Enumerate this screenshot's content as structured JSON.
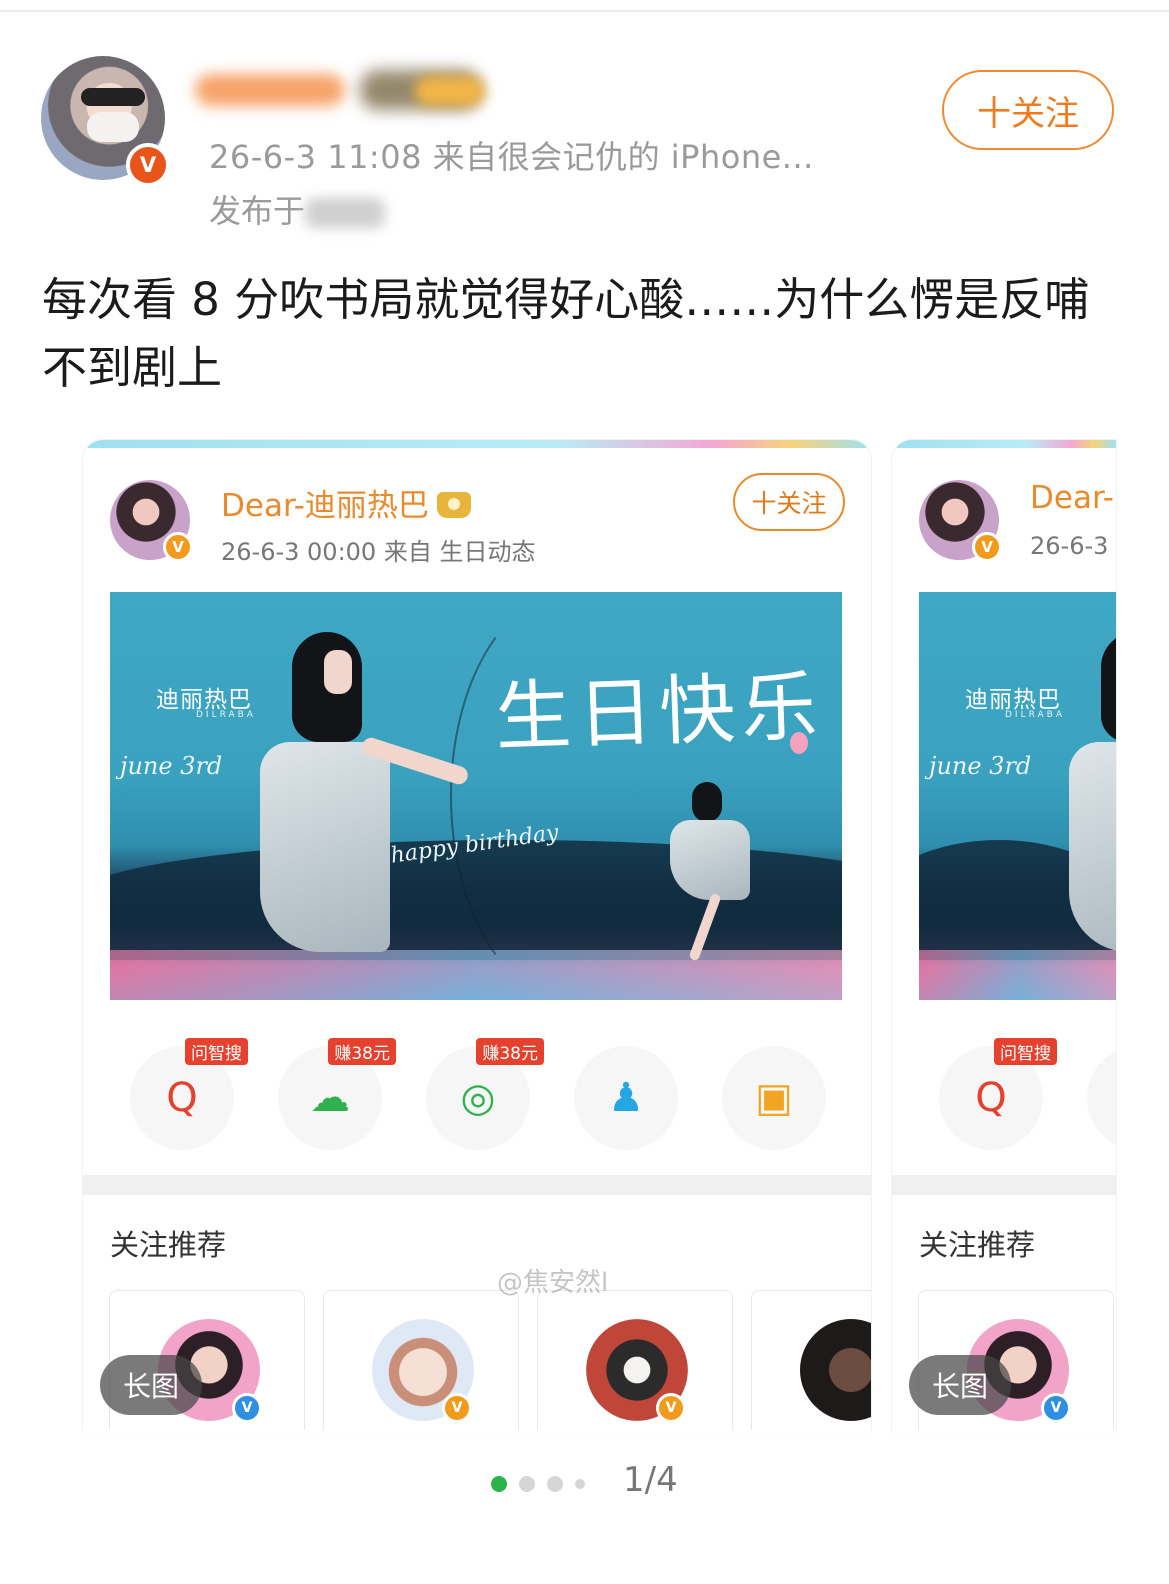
{
  "post": {
    "meta": "26-6-3 11:08  来自很会记仇的 iPhone...",
    "location_prefix": "发布于",
    "follow_label": "十关注",
    "text": "每次看 8 分吹书局就觉得好心酸……为什么愣是反哺不到剧上"
  },
  "embedded": {
    "author_name": "Dear-迪丽热巴",
    "meta": "26-6-3 00:00  来自 生日动态",
    "follow_label": "十关注",
    "author_name_partial": "Dear-",
    "meta_partial": "26-6-3",
    "poster": {
      "brand": "迪丽热巴",
      "brand_sub": "DILRABA",
      "script": "june 3rd",
      "headline": "生日快乐",
      "subline": "happy birthday"
    },
    "share": [
      {
        "icon": "search-icon",
        "glyph": "Q",
        "tag": "问智搜",
        "color": "#e4412e"
      },
      {
        "icon": "wechat-icon",
        "glyph": "☁",
        "tag": "赚38元",
        "color": "#2fb14d"
      },
      {
        "icon": "moments-icon",
        "glyph": "◎",
        "tag": "赚38元",
        "color": "#2fb14d"
      },
      {
        "icon": "qq-icon",
        "glyph": "♟",
        "tag": "",
        "color": "#25a7e6"
      },
      {
        "icon": "save-image-icon",
        "glyph": "▣",
        "tag": "",
        "color": "#f1a523"
      }
    ],
    "recommend_title": "关注推荐",
    "long_image_label": "长图"
  },
  "watermark": "@焦安然l",
  "pager": "1/4",
  "page_index": 1,
  "page_count": 4
}
